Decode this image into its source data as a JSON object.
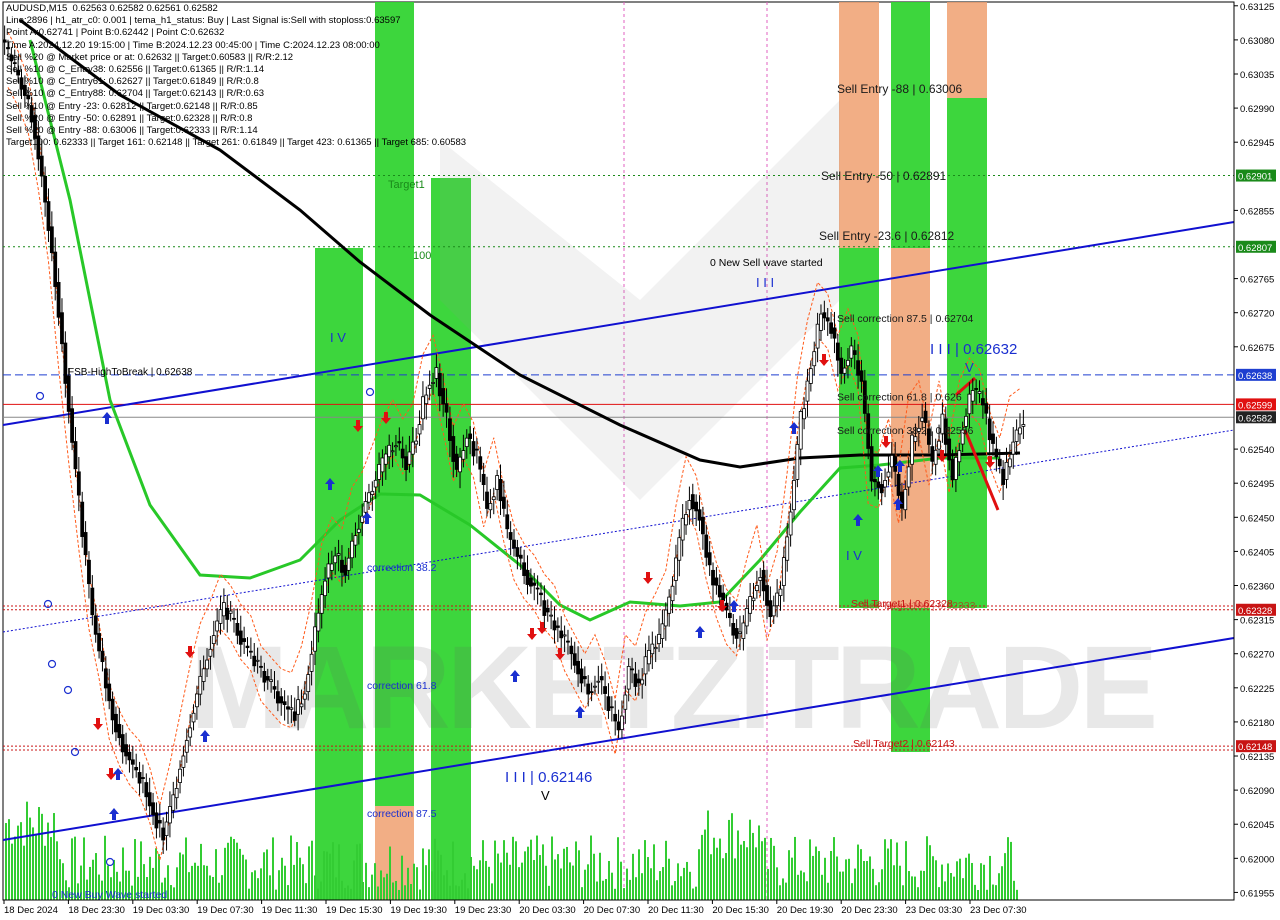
{
  "chart_data": {
    "type": "candlestick",
    "symbol_line": "AUDUSD,M15  0.62563 0.62582 0.62561 0.62582",
    "info_lines": [
      "AUDUSD,M15  0.62563 0.62582 0.62561 0.62582",
      "Line:2896 | h1_atr_c0: 0.001 | tema_h1_status: Buy | Last Signal is:Sell with stoploss:0.63597",
      "Point A:0.62741 | Point B:0.62442 | Point C:0.62632",
      "Time A:2024.12.20 19:15:00 | Time B:2024.12.23 00:45:00 | Time C:2024.12.23 08:00:00",
      "Sell %20 @ Market price or at: 0.62632 || Target:0.60583 || R/R:2.12",
      "Sell %10 @ C_Entry38: 0.62556 || Target:0.61365 || R/R:1.14",
      "Sell %10 @ C_Entry61: 0.62627 || Target:0.61849 || R/R:0.8",
      "Sell %10 @ C_Entry88: 0.62704 || Target:0.62143 || R/R:0.63",
      "Sell %10 @ Entry -23: 0.62812 || Target:0.62148 || R/R:0.85",
      "Sell %20 @ Entry -50: 0.62891 || Target:0.62328 || R/R:0.8",
      "Sell %20 @ Entry -88: 0.63006 || Target:0.62333 || R/R:1.14",
      "Target100: 0.62333 || Target 161: 0.62148 || Target 261: 0.61849 || Target 423: 0.61365 || Target 685: 0.60583"
    ],
    "price_axis": [
      "0.63125",
      "0.63080",
      "0.63035",
      "0.62990",
      "0.62945",
      "0.62855",
      "0.62765",
      "0.62720",
      "0.62675",
      "0.62540",
      "0.62495",
      "0.62450",
      "0.62405",
      "0.62360",
      "0.62315",
      "0.62270",
      "0.62225",
      "0.62180",
      "0.62135",
      "0.62090",
      "0.62045",
      "0.62000",
      "0.61955"
    ],
    "price_tags": [
      {
        "value": "0.62901",
        "color": "#1a8a1a"
      },
      {
        "value": "0.62807",
        "color": "#1a8a1a"
      },
      {
        "value": "0.62638",
        "color": "#1f3fd0"
      },
      {
        "value": "0.62599",
        "color": "#e01010"
      },
      {
        "value": "0.62582",
        "color": "#222222"
      },
      {
        "value": "0.62328",
        "color": "#c81414"
      },
      {
        "value": "0.62148",
        "color": "#c81414"
      }
    ],
    "time_axis": [
      "18 Dec 2024",
      "18 Dec 23:30",
      "19 Dec 03:30",
      "19 Dec 07:30",
      "19 Dec 11:30",
      "19 Dec 15:30",
      "19 Dec 19:30",
      "19 Dec 23:30",
      "20 Dec 03:30",
      "20 Dec 07:30",
      "20 Dec 11:30",
      "20 Dec 15:30",
      "20 Dec 19:30",
      "20 Dec 23:30",
      "23 Dec 03:30",
      "23 Dec 07:30"
    ],
    "ylim": [
      0.61945,
      0.6313
    ],
    "close_series": [
      0.6305,
      0.6302,
      0.6298,
      0.629,
      0.628,
      0.6268,
      0.6255,
      0.6243,
      0.6232,
      0.6225,
      0.6219,
      0.6215,
      0.6212,
      0.621,
      0.6206,
      0.6203,
      0.6208,
      0.6214,
      0.622,
      0.6225,
      0.623,
      0.6233,
      0.6231,
      0.6228,
      0.6226,
      0.6224,
      0.6222,
      0.622,
      0.6219,
      0.6222,
      0.623,
      0.6237,
      0.624,
      0.6238,
      0.6243,
      0.6247,
      0.625,
      0.6253,
      0.6255,
      0.6252,
      0.6256,
      0.6262,
      0.6264,
      0.6258,
      0.6251,
      0.6256,
      0.6253,
      0.6246,
      0.625,
      0.6243,
      0.624,
      0.6237,
      0.6235,
      0.6232,
      0.623,
      0.6228,
      0.6225,
      0.6222,
      0.6224,
      0.622,
      0.6217,
      0.6225,
      0.6223,
      0.6227,
      0.6229,
      0.6234,
      0.6242,
      0.6248,
      0.6245,
      0.6238,
      0.6235,
      0.6231,
      0.6229,
      0.6234,
      0.6238,
      0.6232,
      0.6236,
      0.6246,
      0.6258,
      0.6265,
      0.6272,
      0.627,
      0.6264,
      0.6267,
      0.6263,
      0.625,
      0.6249,
      0.6253,
      0.6246,
      0.6255,
      0.6259,
      0.6252,
      0.6258,
      0.625,
      0.6257,
      0.6262,
      0.626,
      0.6254,
      0.625,
      0.6255,
      0.6258
    ],
    "signals": [
      {
        "label": "0.62632",
        "value": 0.62632
      },
      {
        "label": "0.62146",
        "value": 0.62146
      }
    ],
    "fib_levels": [
      {
        "label": "Sell Entry -88 | 0.63006",
        "value": 0.63006
      },
      {
        "label": "Sell Entry -50 | 0.62891",
        "value": 0.62891
      },
      {
        "label": "Sell Entry -23.6 | 0.62812",
        "value": 0.62812
      },
      {
        "label": "Sell correction 87.5 | 0.62704",
        "value": 0.62704
      },
      {
        "label": "Sell correction 61.8 | 0.626",
        "value": 0.626
      },
      {
        "label": "Sell correction 38.2 | 0.62556",
        "value": 0.62556
      },
      {
        "label": "Sell Target1 | 0.62328",
        "value": 0.62328
      },
      {
        "label": "Sell Target2 | 0.62143",
        "value": 0.62143
      }
    ],
    "annotations": {
      "fsb": "FSB-HighToBreak  | 0.62638",
      "new_sell": "0 New Sell wave started",
      "new_buy": "0 New Buy Wave started",
      "wave_labels": [
        "I V",
        "I I I",
        "I I I | 0.62632",
        "I I I | 0.62146",
        "I V",
        "V"
      ],
      "zone_labels": [
        "Target1",
        "100",
        "correction 38.2",
        "correction 61.8",
        "correction 87.5"
      ],
      "sell_target100": "Sell Target100 | 0.62333"
    },
    "watermark": "MARKETZITRADE"
  },
  "colors": {
    "up_candle": "#000000",
    "down_candle": "#000000",
    "green_zone": "#33d433",
    "orange_zone": "#f0a070",
    "trend_line": "#1010d0",
    "ma_green": "#28c828",
    "ma_black": "#000000",
    "envelope": "#ff5a1a"
  }
}
